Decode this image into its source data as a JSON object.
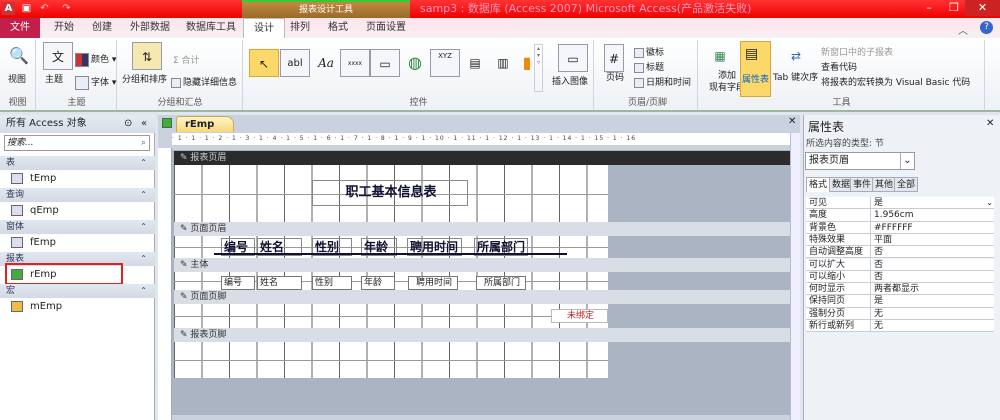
{
  "titlebar": {
    "title": "samp3 : 数据库 (Access 2007)   Microsoft Access(产品激活失败)",
    "context_tab": "报表设计工具",
    "app_icon": "A",
    "minimize": "–",
    "restore": "❐",
    "close": "✕"
  },
  "tabs": {
    "file": "文件",
    "items": [
      "开始",
      "创建",
      "外部数据",
      "数据库工具",
      "设计",
      "排列",
      "格式",
      "页面设置"
    ]
  },
  "ribbon": {
    "view": {
      "label": "视图",
      "group": "视图"
    },
    "theme": {
      "theme": "主题",
      "colors": "颜色",
      "fonts": "字体",
      "group": "主题"
    },
    "grouping": {
      "sort": "分组和排序",
      "totals": "Σ 合计",
      "hide": "隐藏详细信息",
      "group": "分组和汇总"
    },
    "controls": {
      "group": "控件",
      "insert_image": "插入图像",
      "glyphs": [
        "↖",
        "abl",
        "Aa",
        "xxxx",
        "▭",
        "◍",
        "XYZ",
        "▤",
        "▥",
        "▮"
      ]
    },
    "header_footer": {
      "page_number": "页码",
      "logo": "徽标",
      "title": "标题",
      "datetime": "日期和时间",
      "group": "页眉/页脚"
    },
    "tools": {
      "add_fields": "添加\n现有字段",
      "property_sheet": "属性表",
      "tab_order": "Tab 键次序",
      "subreport": "新窗口中的子报表",
      "view_code": "查看代码",
      "convert": "将报表的宏转换为 Visual Basic 代码",
      "group": "工具"
    }
  },
  "nav": {
    "title": "所有 Access 对象",
    "search_placeholder": "搜索...",
    "categories": [
      {
        "name": "表",
        "items": [
          "tEmp"
        ]
      },
      {
        "name": "查询",
        "items": [
          "qEmp"
        ]
      },
      {
        "name": "窗体",
        "items": [
          "fEmp"
        ]
      },
      {
        "name": "报表",
        "items": [
          "rEmp"
        ]
      },
      {
        "name": "宏",
        "items": [
          "mEmp"
        ]
      }
    ]
  },
  "document": {
    "tab": "rEmp",
    "ruler": "· 1 · 1 · 1 · 2 · 1 · 3 · 1 · 4 · 1 · 5 · 1 · 6 · 1 · 7 · 1 · 8 · 1 · 9 · 1 · 10 · 1 · 11 · 1 · 12 · 1 · 13 · 1 · 14 · 1 · 15 · 1 · 16",
    "sections": [
      "报表页眉",
      "页面页眉",
      "主体",
      "页面页脚",
      "报表页脚"
    ],
    "report_title": "职工基本信息表",
    "header_labels": [
      "编号",
      "姓名",
      "性别",
      "年龄",
      "聘用时间",
      "所属部门"
    ],
    "detail_fields": [
      "编号",
      "姓名",
      "性别",
      "年龄",
      "聘用时间",
      "所属部门"
    ],
    "footer_unbound": "未绑定"
  },
  "property_sheet": {
    "title": "属性表",
    "close": "✕",
    "selection_type": "所选内容的类型: 节",
    "selected": "报表页眉",
    "tabs": [
      "格式",
      "数据",
      "事件",
      "其他",
      "全部"
    ],
    "rows": [
      [
        "可见",
        "是"
      ],
      [
        "高度",
        "1.956cm"
      ],
      [
        "背景色",
        "#FFFFFF"
      ],
      [
        "特殊效果",
        "平面"
      ],
      [
        "自动调整高度",
        "否"
      ],
      [
        "可以扩大",
        "否"
      ],
      [
        "可以缩小",
        "否"
      ],
      [
        "何时显示",
        "两者都显示"
      ],
      [
        "保持同页",
        "是"
      ],
      [
        "强制分页",
        "无"
      ],
      [
        "新行或新列",
        "无"
      ]
    ]
  },
  "colors": {
    "title_red": "#ee1111",
    "file_tab": "#c0204a",
    "highlight": "#dd2222"
  }
}
